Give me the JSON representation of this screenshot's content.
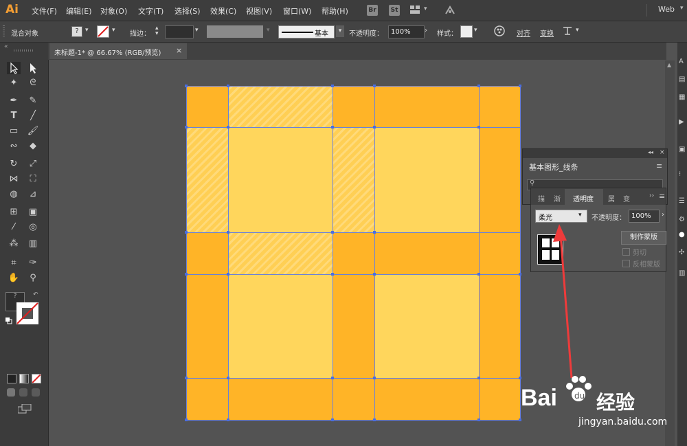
{
  "app": {
    "logo": "Ai"
  },
  "menu": {
    "items": [
      "文件(F)",
      "编辑(E)",
      "对象(O)",
      "文字(T)",
      "选择(S)",
      "效果(C)",
      "视图(V)",
      "窗口(W)",
      "帮助(H)"
    ],
    "badges": [
      "Br",
      "St"
    ],
    "workspace": "Web"
  },
  "control_bar": {
    "selection_label": "混合对象",
    "stroke_label": "描边：",
    "stroke_style": "基本",
    "opacity_label": "不透明度：",
    "opacity_value": "100%",
    "style_label": "样式：",
    "align_label": "对齐",
    "transform_label": "变换"
  },
  "document_tab": {
    "title": "未标题-1* @ 66.67% (RGB/预览)",
    "close": "×"
  },
  "brush_panel": {
    "title": "基本图形_线条"
  },
  "transparency_panel": {
    "tabs": [
      "描",
      "渐",
      "透明度",
      "属",
      "变"
    ],
    "active_tab": "透明度",
    "blend_mode": "柔光",
    "opacity_label": "不透明度：",
    "opacity_value": "100%",
    "make_mask_button": "制作蒙版",
    "clip_label": "剪切",
    "invert_mask_label": "反相蒙版"
  },
  "colors": {
    "dark_orange": "#ffb427",
    "light_yellow": "#ffd65c",
    "arrow": "#ee3b3b",
    "logo": "#f29d33"
  },
  "watermark": {
    "brand": "Bai",
    "brand_suffix": "经验",
    "url": "jingyan.baidu.com"
  }
}
